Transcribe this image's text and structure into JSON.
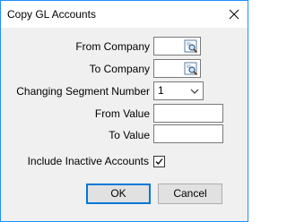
{
  "window": {
    "title": "Copy GL Accounts",
    "close_icon": "close-icon"
  },
  "form": {
    "from_company": {
      "label": "From Company",
      "value": "",
      "icon": "lookup-icon"
    },
    "to_company": {
      "label": "To Company",
      "value": "",
      "icon": "lookup-icon"
    },
    "changing_segment": {
      "label": "Changing Segment Number",
      "value": "1",
      "icon": "chevron-down-icon"
    },
    "from_value": {
      "label": "From Value",
      "value": ""
    },
    "to_value": {
      "label": "To Value",
      "value": ""
    },
    "include_inactive": {
      "label": "Include Inactive Accounts",
      "checked": true
    }
  },
  "buttons": {
    "ok": "OK",
    "cancel": "Cancel"
  },
  "colors": {
    "window_border": "#1e90ff",
    "dialog_background": "#f0f0f0",
    "default_button_border": "#0078d7"
  }
}
